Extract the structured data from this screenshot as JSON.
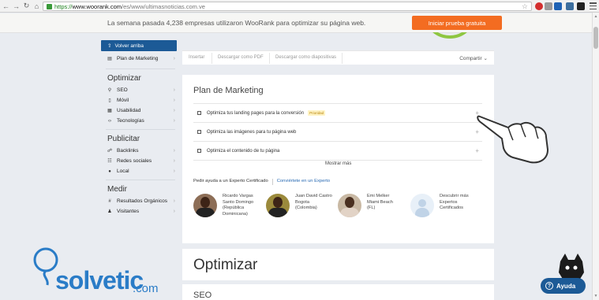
{
  "browser": {
    "url_https": "https://",
    "url_domain": "www.woorank.com",
    "url_path": "/es/www/ultimasnoticias.com.ve"
  },
  "banner": {
    "text": "La semana pasada 4,238 empresas utilizaron WooRank para optimizar su página web.",
    "cta": "Iniciar prueba gratuita"
  },
  "sidebar": {
    "back_to_top": "Volver arriba",
    "marketing_plan": "Plan de Marketing",
    "sections": [
      {
        "title": "Optimizar",
        "items": [
          "SEO",
          "Móvil",
          "Usabilidad",
          "Tecnologías"
        ]
      },
      {
        "title": "Publicitar",
        "items": [
          "Backlinks",
          "Redes sociales",
          "Local"
        ]
      },
      {
        "title": "Medir",
        "items": [
          "Resultados Orgánicos",
          "Visitantes"
        ]
      }
    ]
  },
  "toolbar": {
    "insert": "Insertar",
    "download_pdf": "Descargar como PDF",
    "download_slides": "Descargar como diapositivas",
    "share": "Compartir"
  },
  "marketing": {
    "title": "Plan de Marketing",
    "tasks": [
      {
        "label": "Optimiza tus landing pages para la conversión",
        "badge": "Prioridad"
      },
      {
        "label": "Optimiza las imágenes para tu página web",
        "badge": ""
      },
      {
        "label": "Optimiza el contenido de tu página",
        "badge": ""
      }
    ],
    "show_more": "Mostrar más",
    "ask_expert": "Pedir ayuda a un Experto Certificado",
    "become_expert": "Conviértete en un Experto",
    "experts": [
      {
        "lines": [
          "Ricardo Vargas",
          "Santo Domingo",
          "(República",
          "Dominicana)"
        ]
      },
      {
        "lines": [
          "Juan David Castro",
          "Bogota",
          "(Colombia)"
        ]
      },
      {
        "lines": [
          "Emi Melker",
          "Miami Beach",
          "(FL)"
        ]
      },
      {
        "lines": [
          "Descubrir más",
          "Expertos",
          "Certificados"
        ]
      }
    ]
  },
  "optimize_title": "Optimizar",
  "seo_title": "SEO",
  "help_button": "Ayuda",
  "logo": {
    "main": "solvetic",
    "suffix": ".com"
  },
  "colors": {
    "accent": "#1c5a96",
    "cta": "#f36c21",
    "brand": "#2a7cc7"
  }
}
